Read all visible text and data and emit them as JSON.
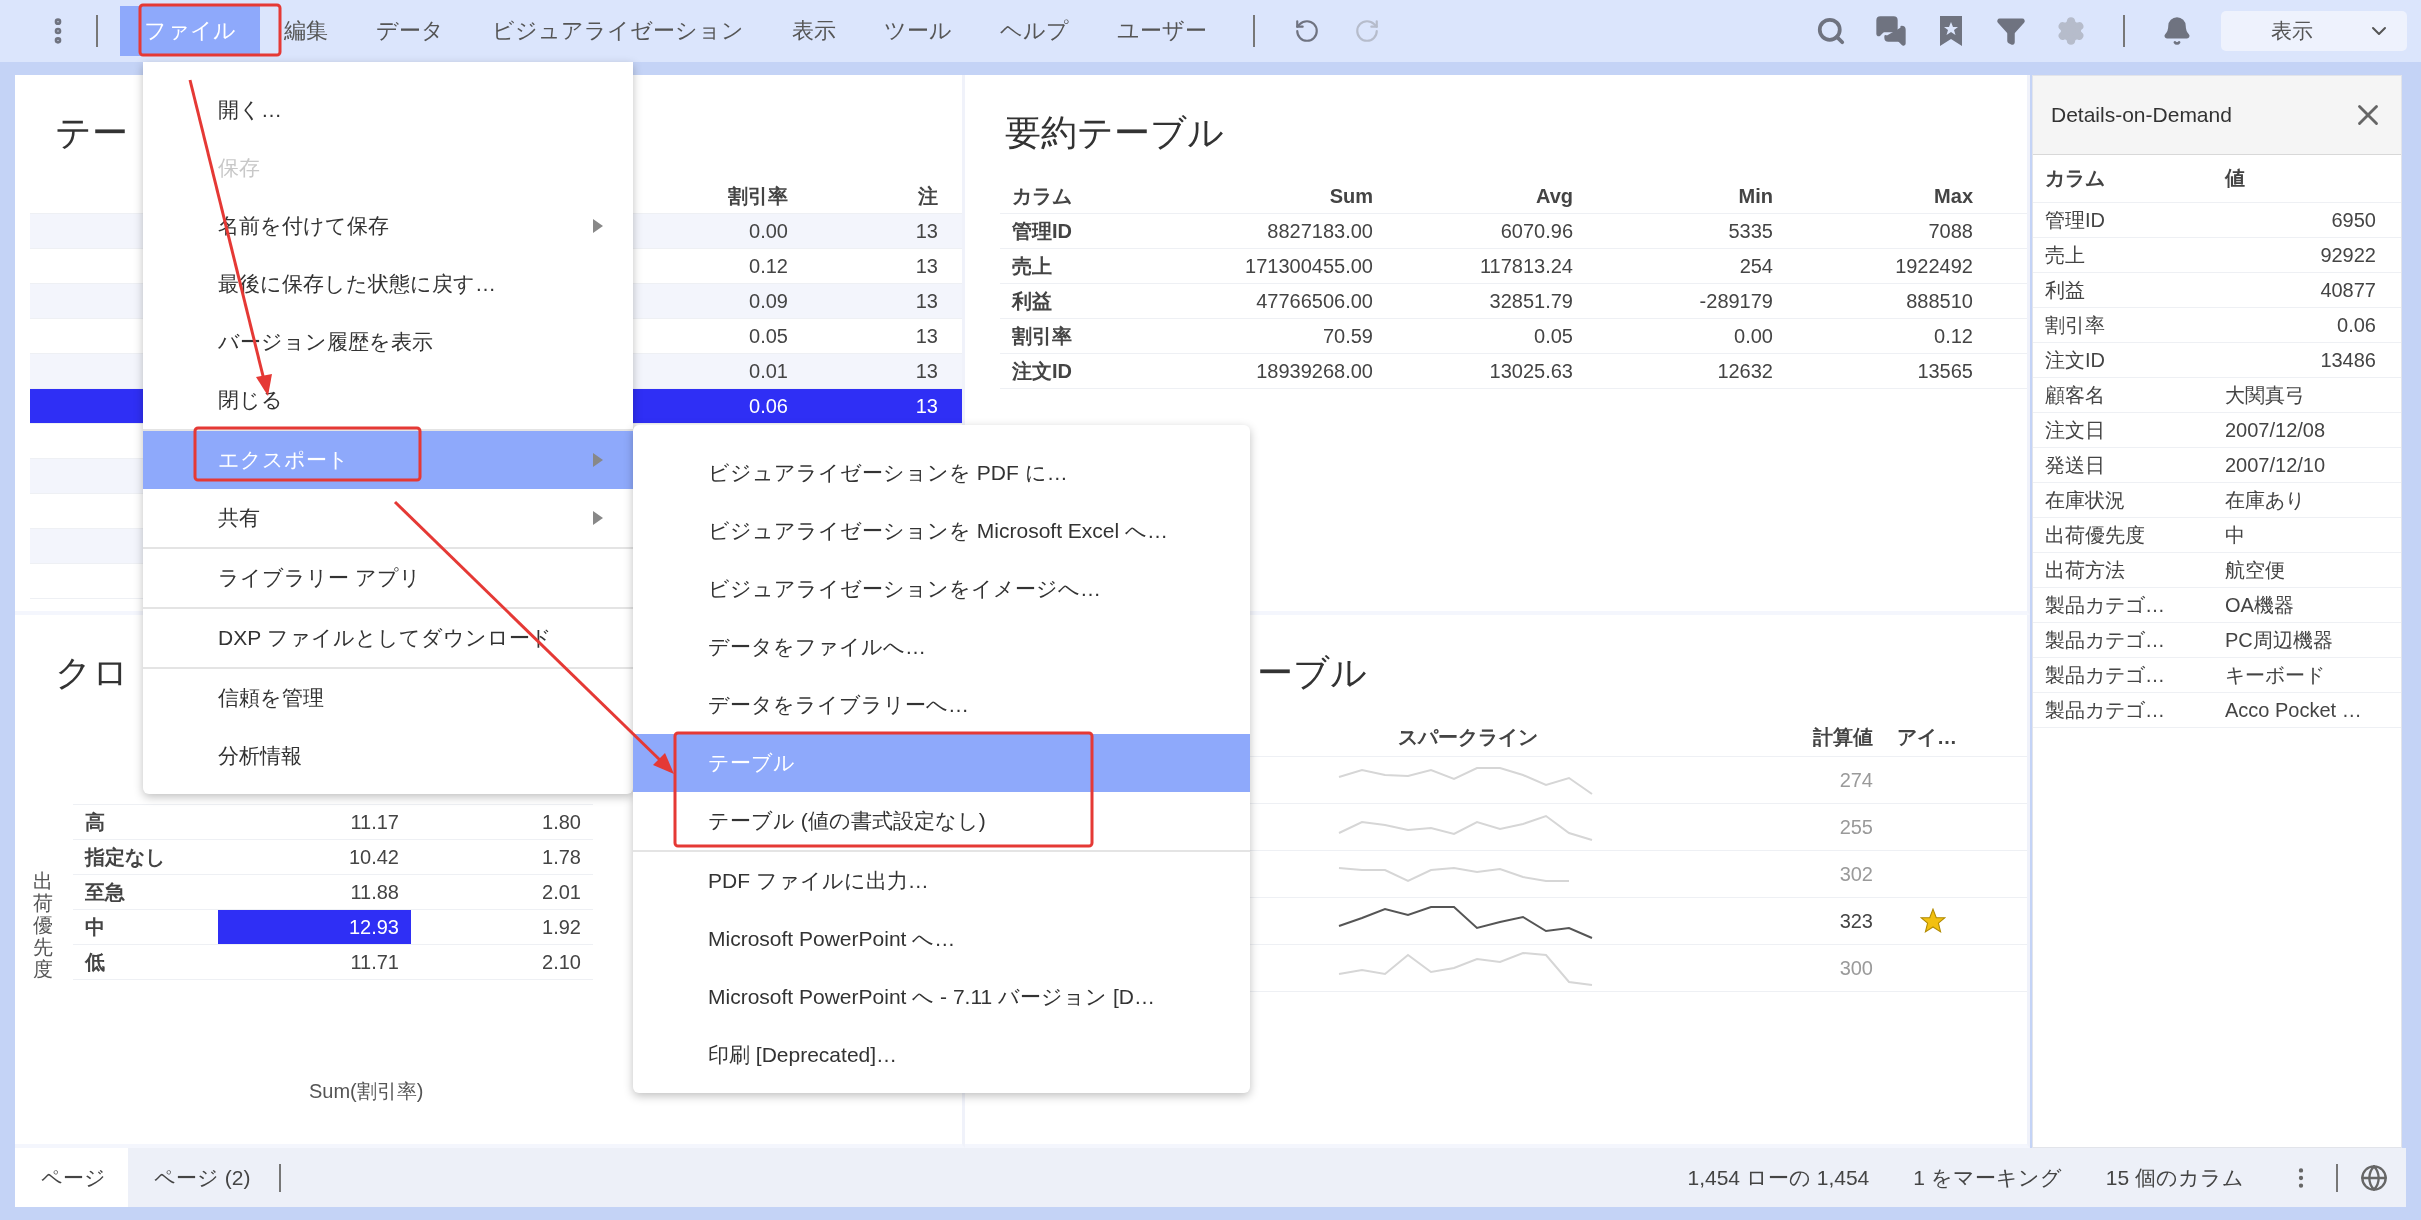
{
  "toolbar": {
    "menus": [
      {
        "label": "ファイル",
        "selected": true
      },
      {
        "label": "編集",
        "selected": false
      },
      {
        "label": "データ",
        "selected": false
      },
      {
        "label": "ビジュアライゼーション",
        "selected": false
      },
      {
        "label": "表示",
        "selected": false
      },
      {
        "label": "ツール",
        "selected": false
      },
      {
        "label": "ヘルプ",
        "selected": false
      },
      {
        "label": "ユーザー",
        "selected": false
      }
    ],
    "history": [
      {
        "kind": "undo",
        "disabled": false
      },
      {
        "kind": "redo",
        "disabled": true
      }
    ],
    "tools": [
      {
        "kind": "search",
        "disabled": false
      },
      {
        "kind": "chat",
        "disabled": false
      },
      {
        "kind": "bookmark",
        "disabled": false
      },
      {
        "kind": "filter",
        "disabled": false
      },
      {
        "kind": "settings",
        "disabled": true
      }
    ],
    "view_dropdown": {
      "value": "表示"
    }
  },
  "table_panel": {
    "title": "テー",
    "columns": [
      "割引率",
      "注"
    ],
    "rows": [
      {
        "cells": [
          "0.00",
          "13"
        ],
        "selected": false
      },
      {
        "cells": [
          "0.12",
          "13"
        ],
        "selected": false
      },
      {
        "cells": [
          "0.09",
          "13"
        ],
        "selected": false
      },
      {
        "cells": [
          "0.05",
          "13"
        ],
        "selected": false
      },
      {
        "cells": [
          "0.01",
          "13"
        ],
        "selected": false
      },
      {
        "cells": [
          "0.06",
          "13"
        ],
        "selected": true
      }
    ]
  },
  "cross_table": {
    "title": "クロ",
    "axis_label": "出荷優先度",
    "rows": [
      {
        "label": "高",
        "cells": [
          {
            "value": "11.17",
            "selected": false
          },
          {
            "value": "1.80",
            "selected": false
          }
        ]
      },
      {
        "label": "指定なし",
        "cells": [
          {
            "value": "10.42",
            "selected": false
          },
          {
            "value": "1.78",
            "selected": false
          }
        ]
      },
      {
        "label": "至急",
        "cells": [
          {
            "value": "11.88",
            "selected": false
          },
          {
            "value": "2.01",
            "selected": false
          }
        ]
      },
      {
        "label": "中",
        "cells": [
          {
            "value": "12.93",
            "selected": true
          },
          {
            "value": "1.92",
            "selected": false
          }
        ]
      },
      {
        "label": "低",
        "cells": [
          {
            "value": "11.71",
            "selected": false
          },
          {
            "value": "2.10",
            "selected": false
          }
        ]
      }
    ],
    "footer": "Sum(割引率)"
  },
  "summary_table": {
    "title": "要約テーブル",
    "columns": [
      "カラム",
      "Sum",
      "Avg",
      "Min",
      "Max"
    ],
    "rows": [
      [
        "管理ID",
        "8827183.00",
        "6070.96",
        "5335",
        "7088"
      ],
      [
        "売上",
        "171300455.00",
        "117813.24",
        "254",
        "1922492"
      ],
      [
        "利益",
        "47766506.00",
        "32851.79",
        "-289179",
        "888510"
      ],
      [
        "割引率",
        "70.59",
        "0.05",
        "0.00",
        "0.12"
      ],
      [
        "注文ID",
        "18939268.00",
        "13025.63",
        "12632",
        "13565"
      ]
    ]
  },
  "graphic_table": {
    "title": "ーブル",
    "columns": [
      "スパークライン",
      "計算値",
      "アイ…"
    ],
    "rows": [
      {
        "value": "274",
        "selected": false,
        "starred": false
      },
      {
        "value": "255",
        "selected": false,
        "starred": false
      },
      {
        "value": "302",
        "selected": false,
        "starred": false
      },
      {
        "value": "323",
        "selected": true,
        "starred": true
      },
      {
        "value": "300",
        "selected": false,
        "starred": false
      }
    ]
  },
  "details": {
    "title": "Details-on-Demand",
    "columns": [
      "カラム",
      "値"
    ],
    "rows": [
      {
        "name": "管理ID",
        "value": "6950",
        "kind": "number"
      },
      {
        "name": "売上",
        "value": "92922",
        "kind": "number"
      },
      {
        "name": "利益",
        "value": "40877",
        "kind": "number"
      },
      {
        "name": "割引率",
        "value": "0.06",
        "kind": "number"
      },
      {
        "name": "注文ID",
        "value": "13486",
        "kind": "number"
      },
      {
        "name": "顧客名",
        "value": "大関真弓",
        "kind": "text"
      },
      {
        "name": "注文日",
        "value": "2007/12/08",
        "kind": "text"
      },
      {
        "name": "発送日",
        "value": "2007/12/10",
        "kind": "text"
      },
      {
        "name": "在庫状況",
        "value": "在庫あり",
        "kind": "text"
      },
      {
        "name": "出荷優先度",
        "value": "中",
        "kind": "text"
      },
      {
        "name": "出荷方法",
        "value": "航空便",
        "kind": "text"
      },
      {
        "name": "製品カテゴ…",
        "value": "OA機器",
        "kind": "text"
      },
      {
        "name": "製品カテゴ…",
        "value": "PC周辺機器",
        "kind": "text"
      },
      {
        "name": "製品カテゴ…",
        "value": "キーボード",
        "kind": "text"
      },
      {
        "name": "製品カテゴ…",
        "value": "Acco Pocket …",
        "kind": "text"
      }
    ]
  },
  "status_bar": {
    "tabs": [
      {
        "label": "ページ",
        "selected": true
      },
      {
        "label": "ページ (2)",
        "selected": false
      }
    ],
    "items": [
      "1,454 ローの 1,454",
      "1 をマーキング",
      "15 個のカラム"
    ]
  },
  "file_menu": {
    "items": [
      {
        "kind": "item",
        "label": "開く…",
        "disabled": false,
        "submenu": false,
        "selected": false
      },
      {
        "kind": "item",
        "label": "保存",
        "disabled": true,
        "submenu": false,
        "selected": false
      },
      {
        "kind": "item",
        "label": "名前を付けて保存",
        "disabled": false,
        "submenu": true,
        "selected": false
      },
      {
        "kind": "item",
        "label": "最後に保存した状態に戻す…",
        "disabled": false,
        "submenu": false,
        "selected": false
      },
      {
        "kind": "item",
        "label": "バージョン履歴を表示",
        "disabled": false,
        "submenu": false,
        "selected": false
      },
      {
        "kind": "item",
        "label": "閉じる",
        "disabled": false,
        "submenu": false,
        "selected": false
      },
      {
        "kind": "separator"
      },
      {
        "kind": "item",
        "label": "エクスポート",
        "disabled": false,
        "submenu": true,
        "selected": true
      },
      {
        "kind": "item",
        "label": "共有",
        "disabled": false,
        "submenu": true,
        "selected": false
      },
      {
        "kind": "separator"
      },
      {
        "kind": "item",
        "label": "ライブラリー アプリ",
        "disabled": false,
        "submenu": false,
        "selected": false
      },
      {
        "kind": "separator"
      },
      {
        "kind": "item",
        "label": "DXP ファイルとしてダウンロード",
        "disabled": false,
        "submenu": false,
        "selected": false
      },
      {
        "kind": "separator"
      },
      {
        "kind": "item",
        "label": "信頼を管理",
        "disabled": false,
        "submenu": false,
        "selected": false
      },
      {
        "kind": "item",
        "label": "分析情報",
        "disabled": false,
        "submenu": false,
        "selected": false
      }
    ]
  },
  "export_menu": {
    "items": [
      {
        "kind": "item",
        "label": "ビジュアライゼーションを PDF に…",
        "selected": false
      },
      {
        "kind": "item",
        "label": "ビジュアライゼーションを Microsoft Excel へ…",
        "selected": false
      },
      {
        "kind": "item",
        "label": "ビジュアライゼーションをイメージへ…",
        "selected": false
      },
      {
        "kind": "item",
        "label": "データをファイルへ…",
        "selected": false
      },
      {
        "kind": "item",
        "label": "データをライブラリーへ…",
        "selected": false
      },
      {
        "kind": "item",
        "label": "テーブル",
        "selected": true
      },
      {
        "kind": "item",
        "label": "テーブル (値の書式設定なし)",
        "selected": false
      },
      {
        "kind": "separator"
      },
      {
        "kind": "item",
        "label": "PDF ファイルに出力…",
        "selected": false
      },
      {
        "kind": "item",
        "label": "Microsoft PowerPoint へ…",
        "selected": false
      },
      {
        "kind": "item",
        "label": "Microsoft PowerPoint へ - 7.11 バージョン [D…",
        "selected": false
      },
      {
        "kind": "item",
        "label": "印刷 [Deprecated]…",
        "selected": false
      }
    ]
  }
}
